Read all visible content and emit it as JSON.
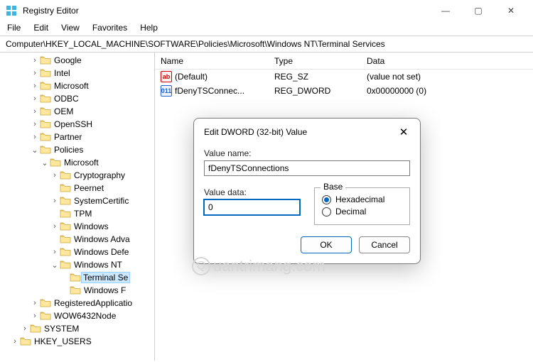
{
  "window": {
    "title": "Registry Editor",
    "buttons": {
      "min": "—",
      "max": "▢",
      "close": "✕"
    }
  },
  "menu": [
    "File",
    "Edit",
    "View",
    "Favorites",
    "Help"
  ],
  "address": "Computer\\HKEY_LOCAL_MACHINE\\SOFTWARE\\Policies\\Microsoft\\Windows NT\\Terminal Services",
  "tree": [
    {
      "depth": 3,
      "chev": "›",
      "label": "Google"
    },
    {
      "depth": 3,
      "chev": "›",
      "label": "Intel"
    },
    {
      "depth": 3,
      "chev": "›",
      "label": "Microsoft"
    },
    {
      "depth": 3,
      "chev": "›",
      "label": "ODBC"
    },
    {
      "depth": 3,
      "chev": "›",
      "label": "OEM"
    },
    {
      "depth": 3,
      "chev": "›",
      "label": "OpenSSH"
    },
    {
      "depth": 3,
      "chev": "›",
      "label": "Partner"
    },
    {
      "depth": 3,
      "chev": "v",
      "label": "Policies",
      "open": true
    },
    {
      "depth": 4,
      "chev": "v",
      "label": "Microsoft",
      "open": true
    },
    {
      "depth": 5,
      "chev": "›",
      "label": "Cryptography"
    },
    {
      "depth": 5,
      "chev": " ",
      "label": "Peernet"
    },
    {
      "depth": 5,
      "chev": "›",
      "label": "SystemCertific"
    },
    {
      "depth": 5,
      "chev": " ",
      "label": "TPM"
    },
    {
      "depth": 5,
      "chev": "›",
      "label": "Windows"
    },
    {
      "depth": 5,
      "chev": " ",
      "label": "Windows Adva"
    },
    {
      "depth": 5,
      "chev": "›",
      "label": "Windows Defe"
    },
    {
      "depth": 5,
      "chev": "v",
      "label": "Windows NT",
      "open": true
    },
    {
      "depth": 6,
      "chev": " ",
      "label": "Terminal Se",
      "selected": true
    },
    {
      "depth": 6,
      "chev": " ",
      "label": "Windows F"
    },
    {
      "depth": 3,
      "chev": "›",
      "label": "RegisteredApplicatio"
    },
    {
      "depth": 3,
      "chev": "›",
      "label": "WOW6432Node"
    },
    {
      "depth": 2,
      "chev": "›",
      "label": "SYSTEM"
    },
    {
      "depth": 1,
      "chev": "›",
      "label": "HKEY_USERS"
    }
  ],
  "columns": {
    "name": "Name",
    "type": "Type",
    "data": "Data"
  },
  "rows": [
    {
      "icon": "sz",
      "name": "(Default)",
      "type": "REG_SZ",
      "data": "(value not set)"
    },
    {
      "icon": "dw",
      "name": "fDenyTSConnec...",
      "type": "REG_DWORD",
      "data": "0x00000000 (0)"
    }
  ],
  "dialog": {
    "title": "Edit DWORD (32-bit) Value",
    "valueNameLabel": "Value name:",
    "valueName": "fDenyTSConnections",
    "valueDataLabel": "Value data:",
    "valueData": "0",
    "baseLabel": "Base",
    "hex": "Hexadecimal",
    "dec": "Decimal",
    "baseSelected": "hex",
    "ok": "OK",
    "cancel": "Cancel",
    "close": "✕"
  },
  "watermark": "uantrimang.com"
}
